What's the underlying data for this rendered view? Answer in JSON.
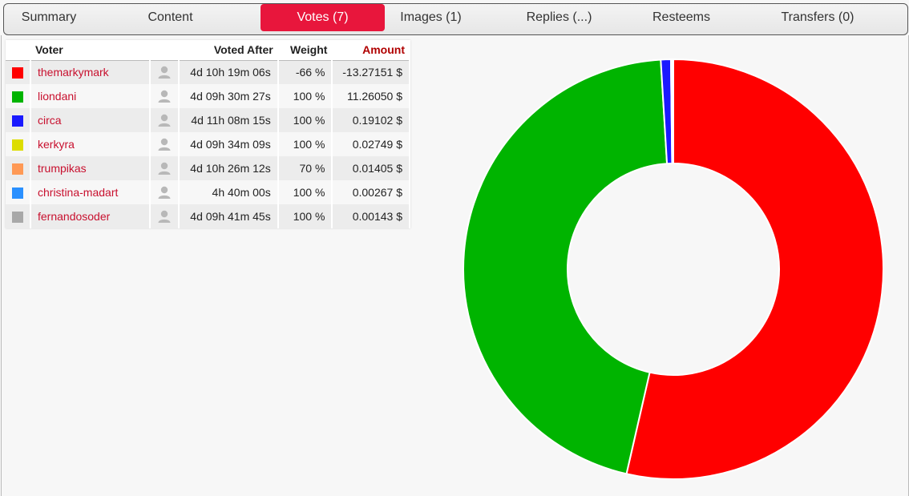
{
  "tabs": [
    {
      "label": "Summary",
      "active": false
    },
    {
      "label": "Content",
      "active": false
    },
    {
      "label": "Votes (7)",
      "active": true
    },
    {
      "label": "Images (1)",
      "active": false
    },
    {
      "label": "Replies (...)",
      "active": false
    },
    {
      "label": "Resteems",
      "active": false
    },
    {
      "label": "Transfers (0)",
      "active": false
    }
  ],
  "table": {
    "headers": {
      "voter": "Voter",
      "voted_after": "Voted After",
      "weight": "Weight",
      "amount": "Amount"
    },
    "rows": [
      {
        "color": "#ff0000",
        "voter": "themarkymark",
        "voted_after": "4d 10h 19m 06s",
        "weight": "-66 %",
        "amount": "-13.27151 $"
      },
      {
        "color": "#00b400",
        "voter": "liondani",
        "voted_after": "4d 09h 30m 27s",
        "weight": "100 %",
        "amount": "11.26050 $"
      },
      {
        "color": "#1a1aff",
        "voter": "circa",
        "voted_after": "4d 11h 08m 15s",
        "weight": "100 %",
        "amount": "0.19102 $"
      },
      {
        "color": "#dddd00",
        "voter": "kerkyra",
        "voted_after": "4d 09h 34m 09s",
        "weight": "100 %",
        "amount": "0.02749 $"
      },
      {
        "color": "#ff9955",
        "voter": "trumpikas",
        "voted_after": "4d 10h 26m 12s",
        "weight": "70 %",
        "amount": "0.01405 $"
      },
      {
        "color": "#2a90ff",
        "voter": "christina-madart",
        "voted_after": "4h 40m 00s",
        "weight": "100 %",
        "amount": "0.00267 $"
      },
      {
        "color": "#a8a8a8",
        "voter": "fernandosoder",
        "voted_after": "4d 09h 41m 45s",
        "weight": "100 %",
        "amount": "0.00143 $"
      }
    ]
  },
  "chart_data": {
    "type": "pie",
    "categories": [
      "themarkymark",
      "liondani",
      "circa",
      "kerkyra",
      "trumpikas",
      "christina-madart",
      "fernandosoder"
    ],
    "values": [
      13.27151,
      11.2605,
      0.19102,
      0.02749,
      0.01405,
      0.00267,
      0.00143
    ],
    "colors": [
      "#ff0000",
      "#00b400",
      "#1a1aff",
      "#dddd00",
      "#ff9955",
      "#2a90ff",
      "#a8a8a8"
    ],
    "donut": true
  }
}
